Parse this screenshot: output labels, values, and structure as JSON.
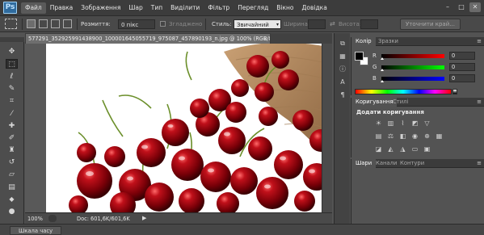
{
  "app": {
    "logo_text": "Ps"
  },
  "menu": {
    "items": [
      "Файл",
      "Правка",
      "Зображення",
      "Шар",
      "Тип",
      "Виділити",
      "Фільтр",
      "Перегляд",
      "Вікно",
      "Довідка"
    ],
    "active_index": 0
  },
  "window_controls": {
    "minimize": "–",
    "maximize": "□",
    "close": "✕"
  },
  "options": {
    "feather_label": "Розмиття:",
    "feather_value": "0 пікс",
    "antialias_label": "Згладжено",
    "style_label": "Стиль:",
    "style_value": "Звичайний",
    "width_label": "Ширина:",
    "height_label": "Висота:",
    "refine_edge_label": "Уточнити край..."
  },
  "document": {
    "tab_title": "577291_352925991438900_100001645055719_975087_457890193_n.jpg @ 100% (RGB/8)",
    "tab_close": "×"
  },
  "status": {
    "zoom": "100%",
    "doc_info": "Doc: 601,6K/601,6K",
    "arrow": "▶"
  },
  "timeline": {
    "tab_label": "Шкала часу"
  },
  "tools": [
    {
      "name": "move-tool-icon",
      "glyph": "✥"
    },
    {
      "name": "marquee-tool-icon",
      "glyph": "⬚"
    },
    {
      "name": "lasso-tool-icon",
      "glyph": "ℓ"
    },
    {
      "name": "quick-select-tool-icon",
      "glyph": "✎"
    },
    {
      "name": "crop-tool-icon",
      "glyph": "⌗"
    },
    {
      "name": "eyedropper-tool-icon",
      "glyph": "⁄"
    },
    {
      "name": "healing-brush-tool-icon",
      "glyph": "✚"
    },
    {
      "name": "brush-tool-icon",
      "glyph": "✐"
    },
    {
      "name": "clone-stamp-tool-icon",
      "glyph": "♜"
    },
    {
      "name": "history-brush-tool-icon",
      "glyph": "↺"
    },
    {
      "name": "eraser-tool-icon",
      "glyph": "▱"
    },
    {
      "name": "gradient-tool-icon",
      "glyph": "▤"
    },
    {
      "name": "blur-tool-icon",
      "glyph": "💧"
    },
    {
      "name": "dodge-tool-icon",
      "glyph": "●"
    }
  ],
  "color_panel": {
    "tab_active": "Колір",
    "tab_inactive": "Зразки",
    "menu_glyph": "≡",
    "r_label": "R",
    "g_label": "G",
    "b_label": "B",
    "r_value": "0",
    "g_value": "0",
    "b_value": "0",
    "colors": {
      "r_track": "#d40000",
      "g_track": "#00a000",
      "b_track": "#1030e0"
    }
  },
  "adjustments_panel": {
    "tab_active": "Коригування",
    "tab_inactive": "Стилі",
    "title": "Додати коригування",
    "menu_glyph": "≡"
  },
  "layers_panel": {
    "tab_active": "Шари",
    "tab_2": "Канали",
    "tab_3": "Контури",
    "menu_glyph": "≡"
  }
}
